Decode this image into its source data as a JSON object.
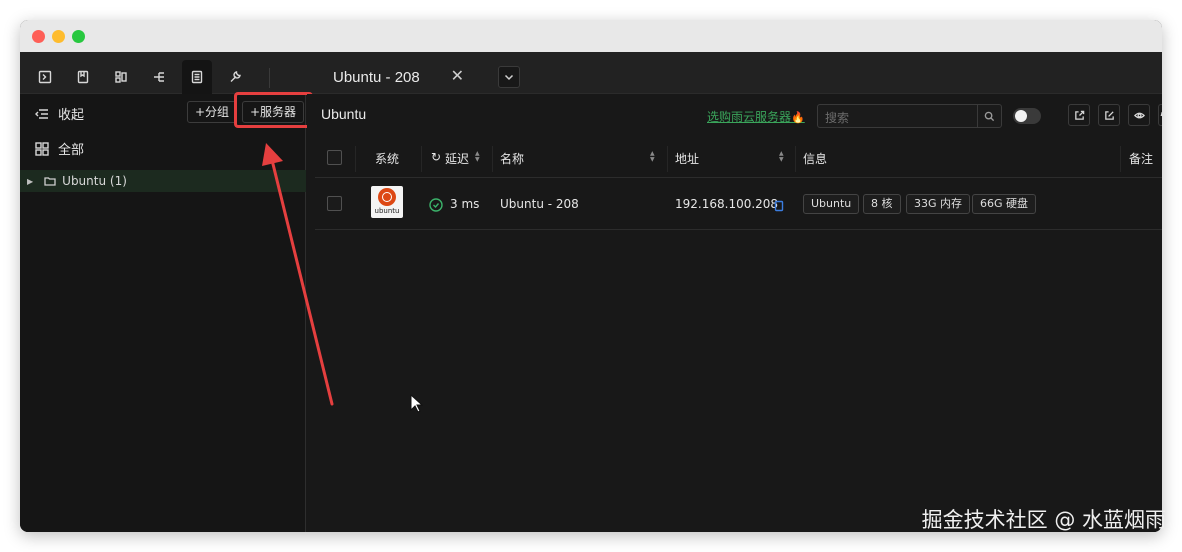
{
  "window": {
    "colors": {
      "close": "#fe5f57",
      "minimize": "#febc2e",
      "maximize": "#28c840"
    }
  },
  "toolbar": {
    "icons": [
      "terminal-icon",
      "bookmark-icon",
      "grid-icon",
      "tree-icon",
      "server-list-icon",
      "wrench-icon"
    ],
    "active_icon": "server-list-icon"
  },
  "tab": {
    "title": "Ubuntu - 208",
    "close_glyph": "✕"
  },
  "sidebar": {
    "collapse_label": "收起",
    "all_label": "全部",
    "add_group_label": "+分组",
    "add_server_label": "+服务器",
    "tree": [
      {
        "label": "Ubuntu (1)"
      }
    ]
  },
  "main": {
    "title": "Ubuntu",
    "promo_link": "选购雨云服务器",
    "search_placeholder": "搜索",
    "table": {
      "headers": {
        "os": "系统",
        "latency": "延迟",
        "name": "名称",
        "address": "地址",
        "info": "信息",
        "notes": "备注"
      },
      "rows": [
        {
          "os": "ubuntu",
          "latency": "3 ms",
          "name": "Ubuntu - 208",
          "address": "192.168.100.208",
          "tags": [
            "Ubuntu",
            "8 核",
            "33G 内存",
            "66G 硬盘"
          ]
        }
      ]
    }
  },
  "annotation": {
    "color": "#e53f3f"
  },
  "watermark": "掘金技术社区 @ 水蓝烟雨"
}
